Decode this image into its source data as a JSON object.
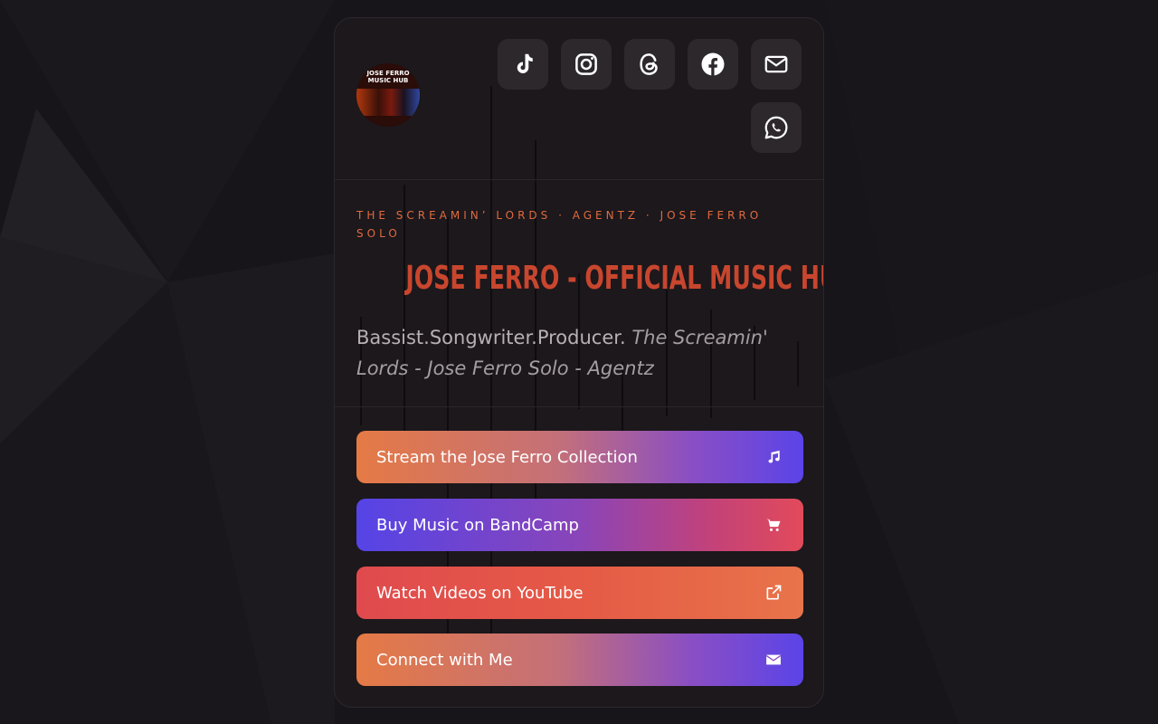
{
  "profile": {
    "avatar_text": "JOSE FERRO MUSIC HUB",
    "kicker": "THE SCREAMIN’ LORDS · AGENTZ · JOSE FERRO SOLO",
    "title": "JOSE FERRO - OFFICIAL MUSIC HUB",
    "bio_plain": "Bassist.Songwriter.Producer.",
    "bio_italic": "The Screamin' Lords - Jose Ferro Solo - Agentz"
  },
  "socials": [
    {
      "icon": "tiktok-icon"
    },
    {
      "icon": "instagram-icon"
    },
    {
      "icon": "threads-icon"
    },
    {
      "icon": "facebook-icon"
    },
    {
      "icon": "mail-icon"
    },
    {
      "icon": "whatsapp-icon"
    }
  ],
  "links": [
    {
      "label": "Stream the Jose Ferro Collection",
      "icon": "music-note-icon"
    },
    {
      "label": "Buy Music on BandCamp",
      "icon": "cart-icon"
    },
    {
      "label": "Watch Videos on YouTube",
      "icon": "external-link-icon"
    },
    {
      "label": "Connect with Me",
      "icon": "envelope-icon"
    }
  ],
  "colors": {
    "background": "#17141a",
    "card": "#1c181c",
    "accent": "#c8462e",
    "kicker": "#e06a3e"
  }
}
